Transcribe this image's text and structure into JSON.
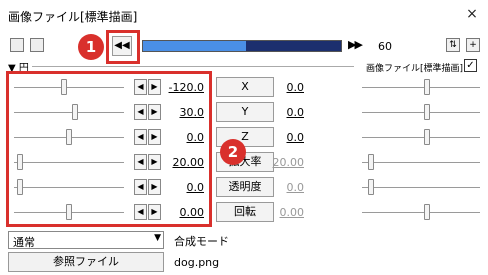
{
  "window": {
    "title": "画像ファイル[標準描画]",
    "close": "×"
  },
  "toolbar": {
    "seek_icon": "rewind-icon",
    "seek_label": "◀◀",
    "end_label": "▶▶",
    "frame_value": "60",
    "progress_fraction": 0.52
  },
  "object": {
    "name": "▼ 円",
    "filter_label": "画像ファイル[標準描画]",
    "filter_checked": "✓"
  },
  "params": [
    {
      "left_value": "-120.0",
      "label": "X",
      "right_value": "0.0",
      "right_disabled": false,
      "slider": 0.45,
      "right_slider": 0.55
    },
    {
      "left_value": "30.0",
      "label": "Y",
      "right_value": "0.0",
      "right_disabled": false,
      "slider": 0.55,
      "right_slider": 0.55
    },
    {
      "left_value": "0.0",
      "label": "Z",
      "right_value": "0.0",
      "right_disabled": false,
      "slider": 0.5,
      "right_slider": 0.55
    },
    {
      "left_value": "20.00",
      "label": "拡大率",
      "right_value": "20.00",
      "right_disabled": true,
      "slider": 0.05,
      "right_slider": 0.08
    },
    {
      "left_value": "0.0",
      "label": "透明度",
      "right_value": "0.0",
      "right_disabled": true,
      "slider": 0.05,
      "right_slider": 0.08
    },
    {
      "left_value": "0.00",
      "label": "回転",
      "right_value": "0.00",
      "right_disabled": true,
      "slider": 0.5,
      "right_slider": 0.55
    }
  ],
  "arrows": {
    "left": "◀",
    "right": "▶"
  },
  "annotations": {
    "badge1": "1",
    "badge2": "2"
  },
  "blend": {
    "value": "通常",
    "arrow": "▼",
    "label": "合成モード"
  },
  "reference": {
    "button": "参照ファイル",
    "file": "dog.png"
  },
  "colors": {
    "highlight": "#d9302c",
    "timeline_dark": "#1c2f6e",
    "timeline_fill": "#4a8fe6"
  }
}
